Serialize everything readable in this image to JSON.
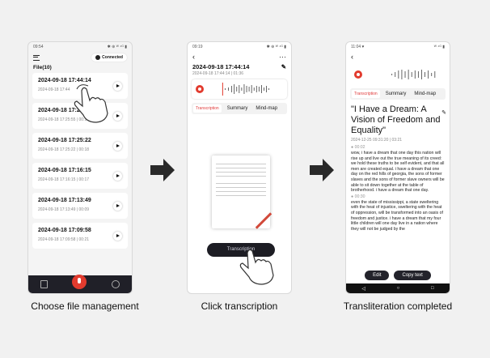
{
  "phone1": {
    "status_time": "09:54",
    "status_icons": "✱ ⊕ ᵂ ⁴ᴳ ▮",
    "connected": "Connected",
    "file_title": "File(10)",
    "files": [
      {
        "title": "2024-09-18 17:44:14",
        "sub": "2024-09-18 17:44"
      },
      {
        "title": "2024-09-18 17:25:55",
        "sub": "2024-09-18 17:25:55 | 00:15"
      },
      {
        "title": "2024-09-18 17:25:22",
        "sub": "2024-09-18 17:25:22 | 00:18"
      },
      {
        "title": "2024-09-18 17:16:15",
        "sub": "2024-09-18 17:16:15 | 00:17"
      },
      {
        "title": "2024-09-18 17:13:49",
        "sub": "2024-09-18 17:13:49 | 00:09"
      },
      {
        "title": "2024-09-18 17:09:58",
        "sub": "2024-09-18 17:09:58 | 00:21"
      }
    ]
  },
  "phone2": {
    "status_time": "09:19",
    "back": "‹",
    "more": "···",
    "title": "2024-09-18 17:44:14",
    "meta": "2024-09-18 17:44:14 | 01:36",
    "tabs": [
      "Transcription",
      "Summary",
      "Mind-map"
    ],
    "button": "Transcription"
  },
  "phone3": {
    "status_time": "11:04 ♥",
    "status_icons": "ᵂ ⁴ᴳ ▮",
    "back": "‹",
    "tabs": [
      "Transcription",
      "Summary",
      "Mind-map"
    ],
    "title": "\"I Have a Dream: A Vision of Freedom and Equality\"",
    "meta": "2024-12-25 09:31:20 | 03:21",
    "ts1": "● 00:02",
    "p1": "wow, i have a dream that one day this nation will rise up and live out the true meaning of its creed: we hold these truths to be self evident, and that all men are created equal. i have a dream that one day on the red hills of georgia, the sons of former slaves and the sons of former slave owners will be able to sit down together at the table of brotherhood. i have a dream that one day.",
    "ts2": "● 00:30",
    "p2": "even the state of mississippi, a state sweltering with the heat of injustice, sweltering with the heat of oppression, will be transformed into an oasis of freedom and justice. i have a dream that my four little children will one day live in a nation where they will not be judged by the",
    "edit": "Edit",
    "copy": "Copy text",
    "nav": [
      "◁",
      "○",
      "□"
    ]
  },
  "captions": {
    "c1": "Choose file management",
    "c2": "Click transcription",
    "c3": "Transliteration completed"
  },
  "colors": {
    "accent": "#e23b2e",
    "dark": "#1d1d24",
    "background": "#f1f1f1"
  }
}
